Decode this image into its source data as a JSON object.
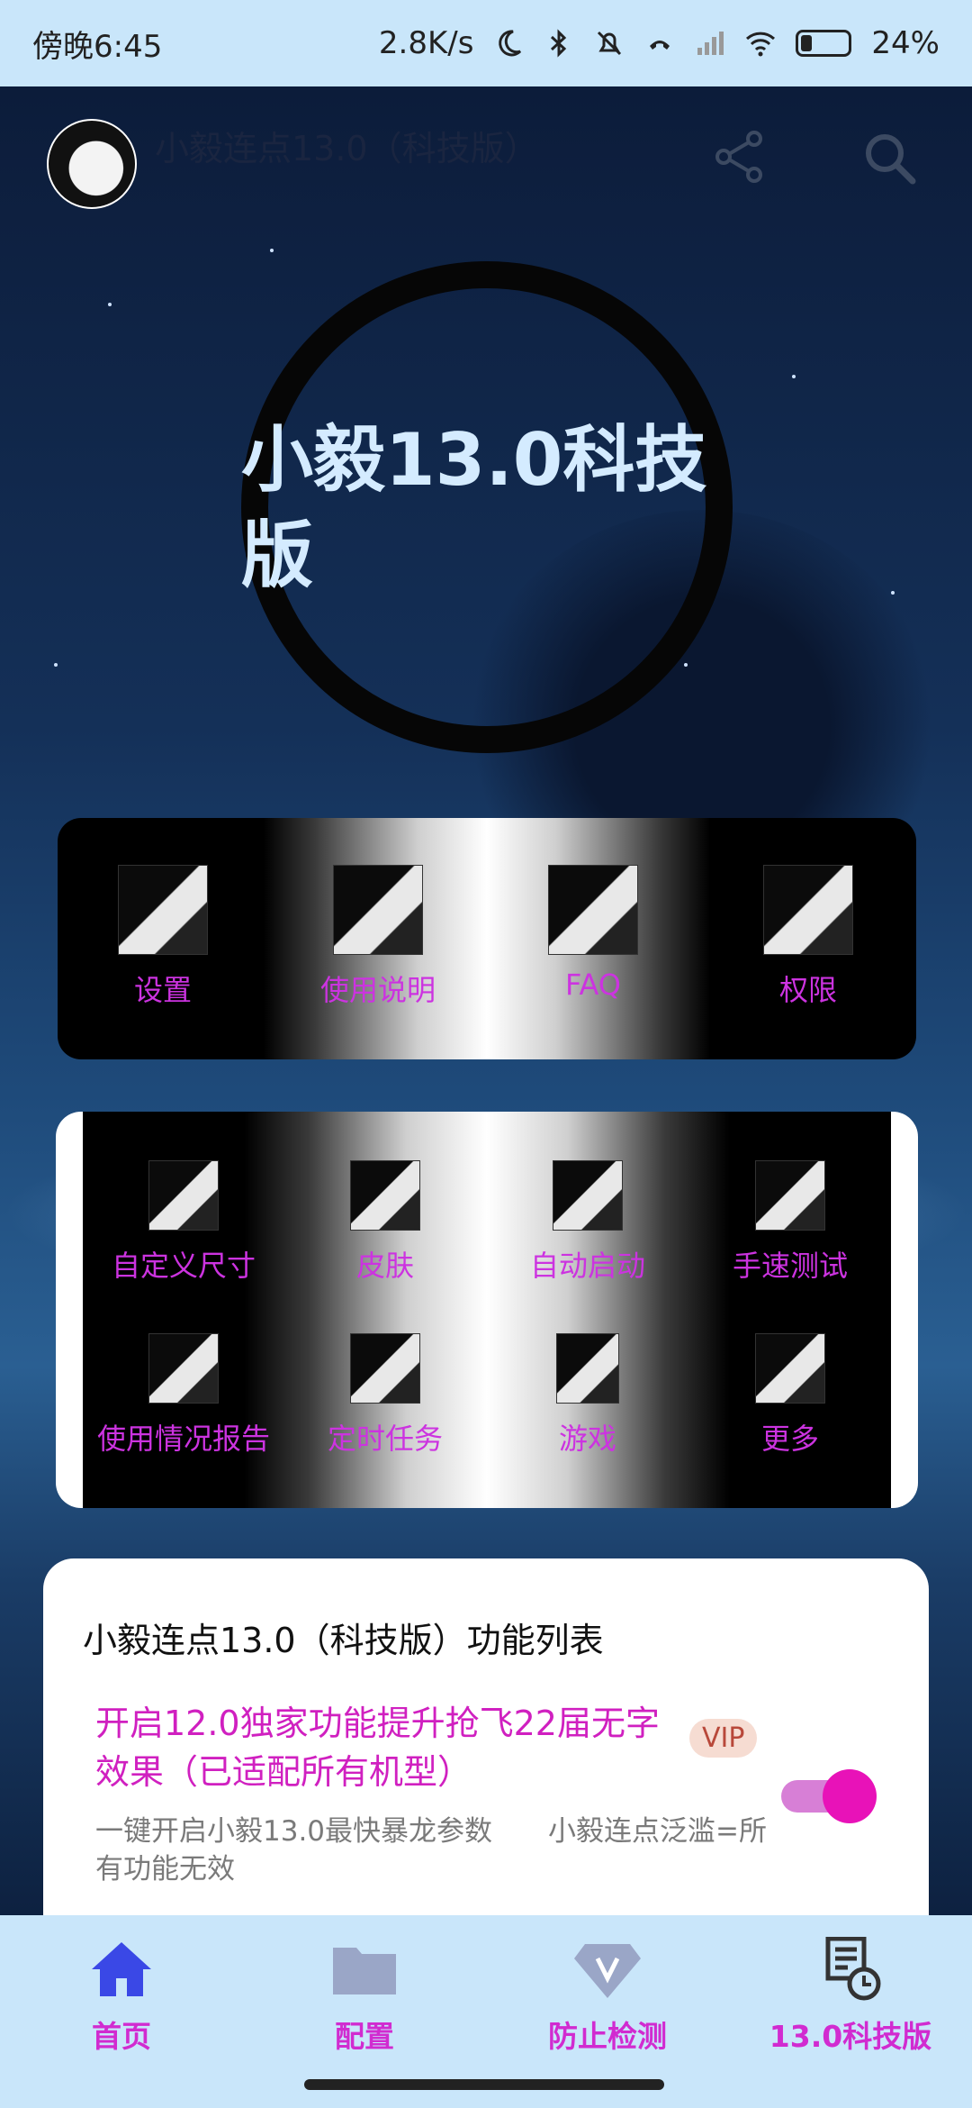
{
  "status_bar": {
    "time": "傍晚6:45",
    "net_speed": "2.8K/s",
    "battery": "24%",
    "battery_level": 0.24
  },
  "app_bar": {
    "title": "小毅连点13.0（科技版）",
    "icons": [
      "avatar",
      "share-icon",
      "search-icon"
    ]
  },
  "hero": {
    "title": "小毅13.0科技版"
  },
  "grid_top": {
    "items": [
      {
        "label": "设置"
      },
      {
        "label": "使用说明"
      },
      {
        "label": "FAQ"
      },
      {
        "label": "权限"
      }
    ]
  },
  "grid_main": {
    "items": [
      {
        "label": "自定义尺寸"
      },
      {
        "label": "皮肤"
      },
      {
        "label": "自动启动"
      },
      {
        "label": "手速测试"
      },
      {
        "label": "使用情况报告"
      },
      {
        "label": "定时任务"
      },
      {
        "label": "游戏"
      },
      {
        "label": "更多"
      }
    ]
  },
  "function_list": {
    "header": "小毅连点13.0（科技版）功能列表",
    "item_title": "开启12.0独家功能提升抢飞22届无字效果（已适配所有机型）",
    "badge": "VIP",
    "description": "一键开启小毅13.0最快暴龙参数　　小毅连点泛滥=所有功能无效",
    "toggle_on": true
  },
  "bottom_nav": {
    "items": [
      {
        "label": "首页",
        "icon": "home-icon"
      },
      {
        "label": "配置",
        "icon": "folder-icon"
      },
      {
        "label": "防止检测",
        "icon": "diamond-icon"
      },
      {
        "label": "13.0科技版",
        "icon": "document-clock-icon"
      }
    ]
  },
  "colors": {
    "status_bar_bg": "#c9e6fa",
    "accent_magenta": "#d12bd0",
    "toggle_knob": "#e812b8",
    "home_icon": "#3a48e6"
  }
}
